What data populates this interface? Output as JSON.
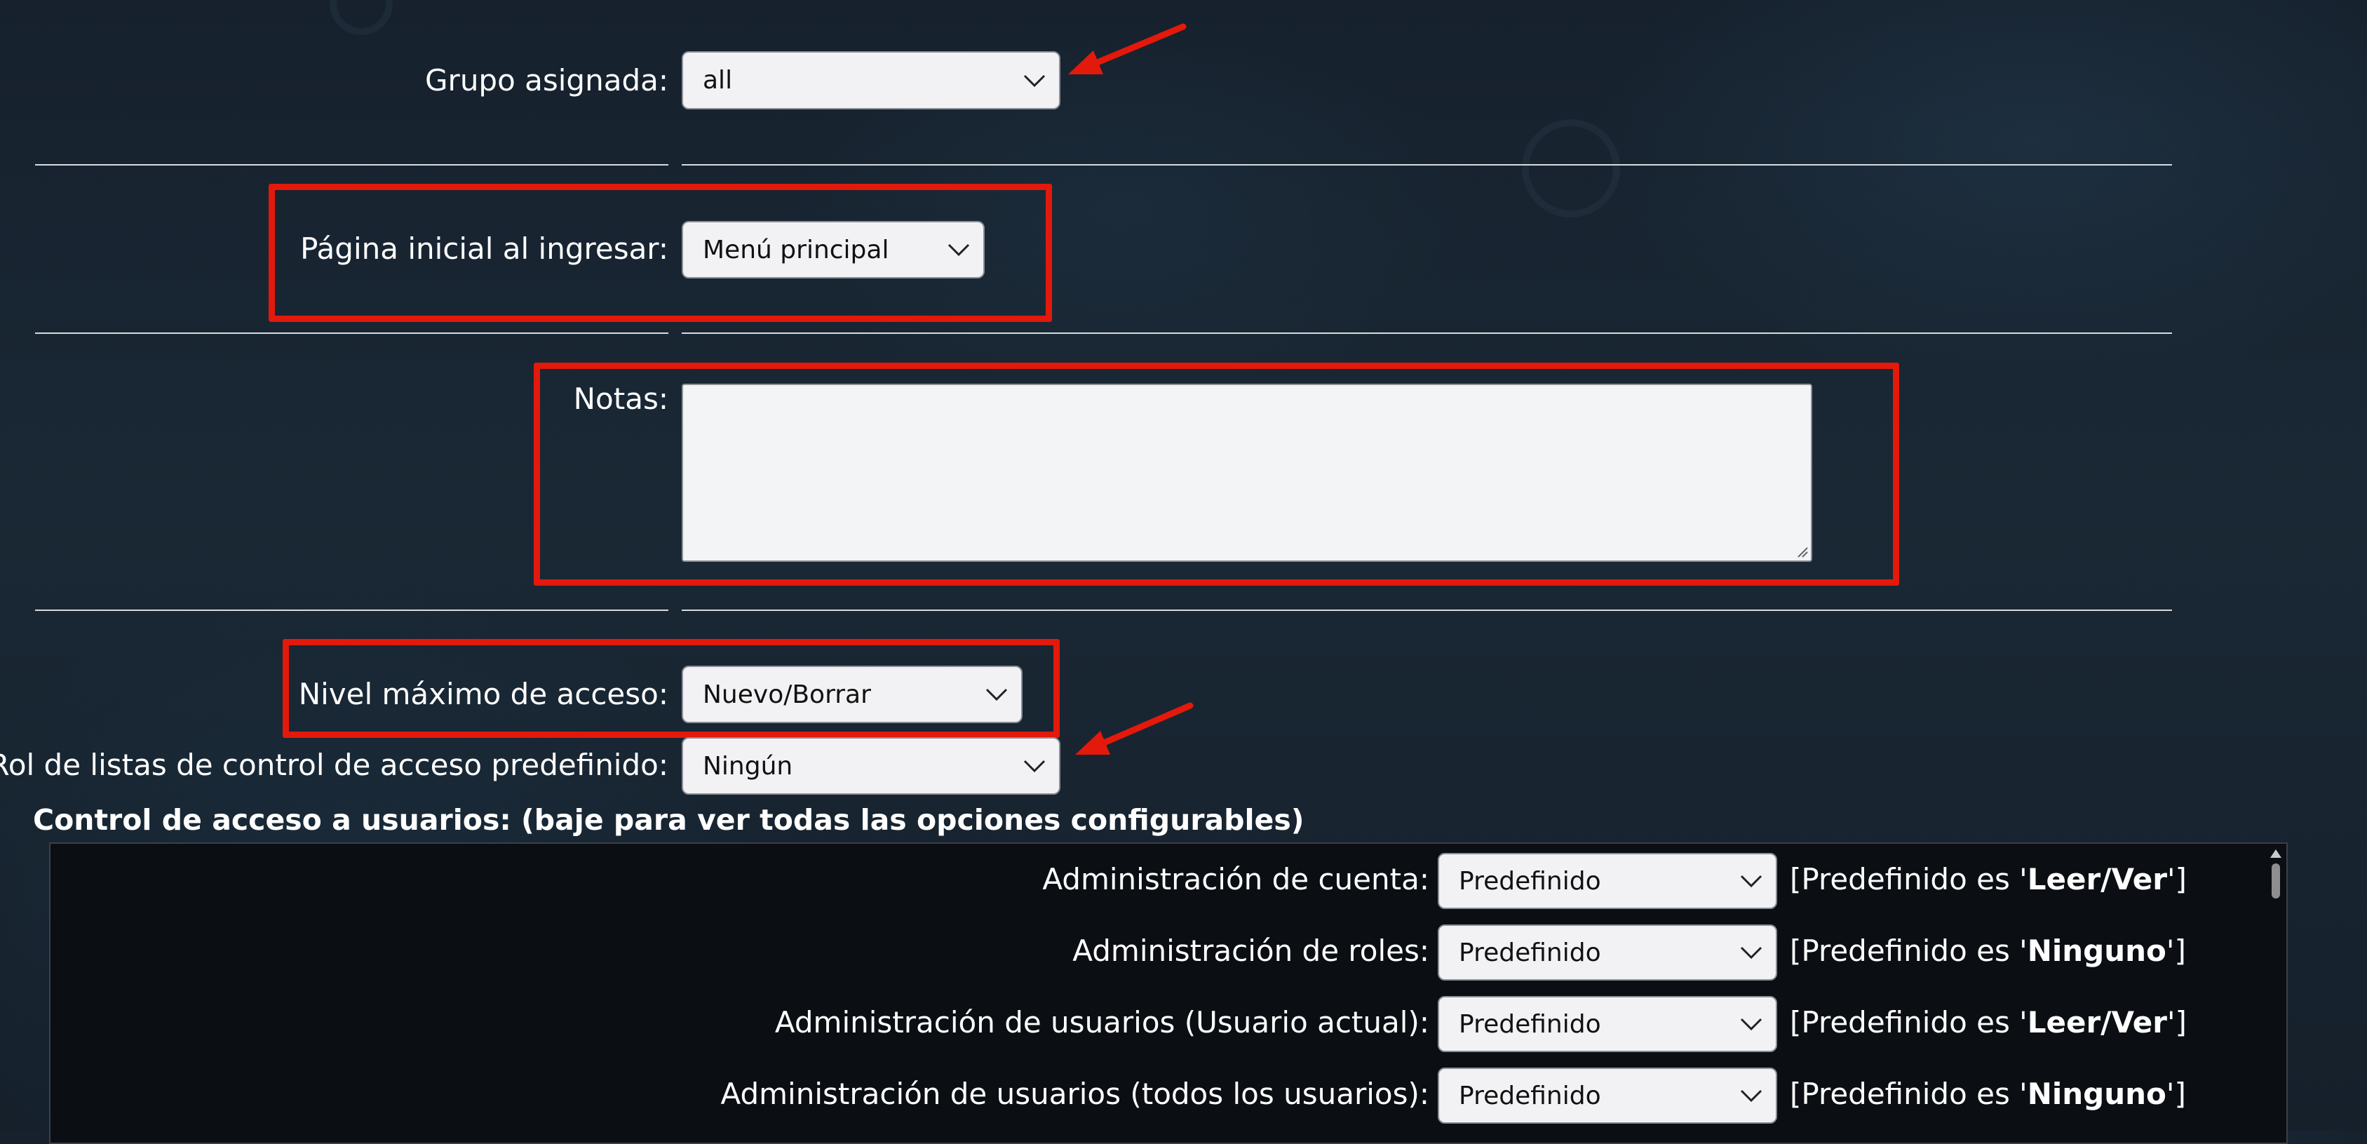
{
  "form": {
    "grupo_asignada": {
      "label": "Grupo asignada:",
      "value": "all"
    },
    "pagina_inicial": {
      "label": "Página inicial al ingresar:",
      "value": "Menú principal"
    },
    "notas": {
      "label": "Notas:",
      "value": ""
    },
    "nivel_maximo": {
      "label": "Nivel máximo de acceso:",
      "value": "Nuevo/Borrar"
    },
    "rol_acl": {
      "label": "Rol de listas de control de acceso predefinido:",
      "value": "Ningún"
    }
  },
  "acl_section": {
    "title": "Control de acceso a usuarios: (baje para ver todas las opciones configurables)",
    "rows": [
      {
        "label": "Administración de cuenta:",
        "value": "Predefinido",
        "note_prefix": "[Predefinido es '",
        "note_value": "Leer/Ver",
        "note_suffix": "']"
      },
      {
        "label": "Administración de roles:",
        "value": "Predefinido",
        "note_prefix": "[Predefinido es '",
        "note_value": "Ninguno",
        "note_suffix": "']"
      },
      {
        "label": "Administración de usuarios (Usuario actual):",
        "value": "Predefinido",
        "note_prefix": "[Predefinido es '",
        "note_value": "Leer/Ver",
        "note_suffix": "']"
      },
      {
        "label": "Administración de usuarios (todos los usuarios):",
        "value": "Predefinido",
        "note_prefix": "[Predefinido es '",
        "note_value": "Ninguno",
        "note_suffix": "']"
      }
    ]
  },
  "icons": {
    "select_chevron": "chevron-down-icon",
    "annotation_arrow": "red-arrow-icon",
    "highlight_box": "red-highlight-box"
  },
  "colors": {
    "annotation_red": "#e3190b",
    "background": "#1a2835",
    "control_bg": "#f2f2f4"
  }
}
